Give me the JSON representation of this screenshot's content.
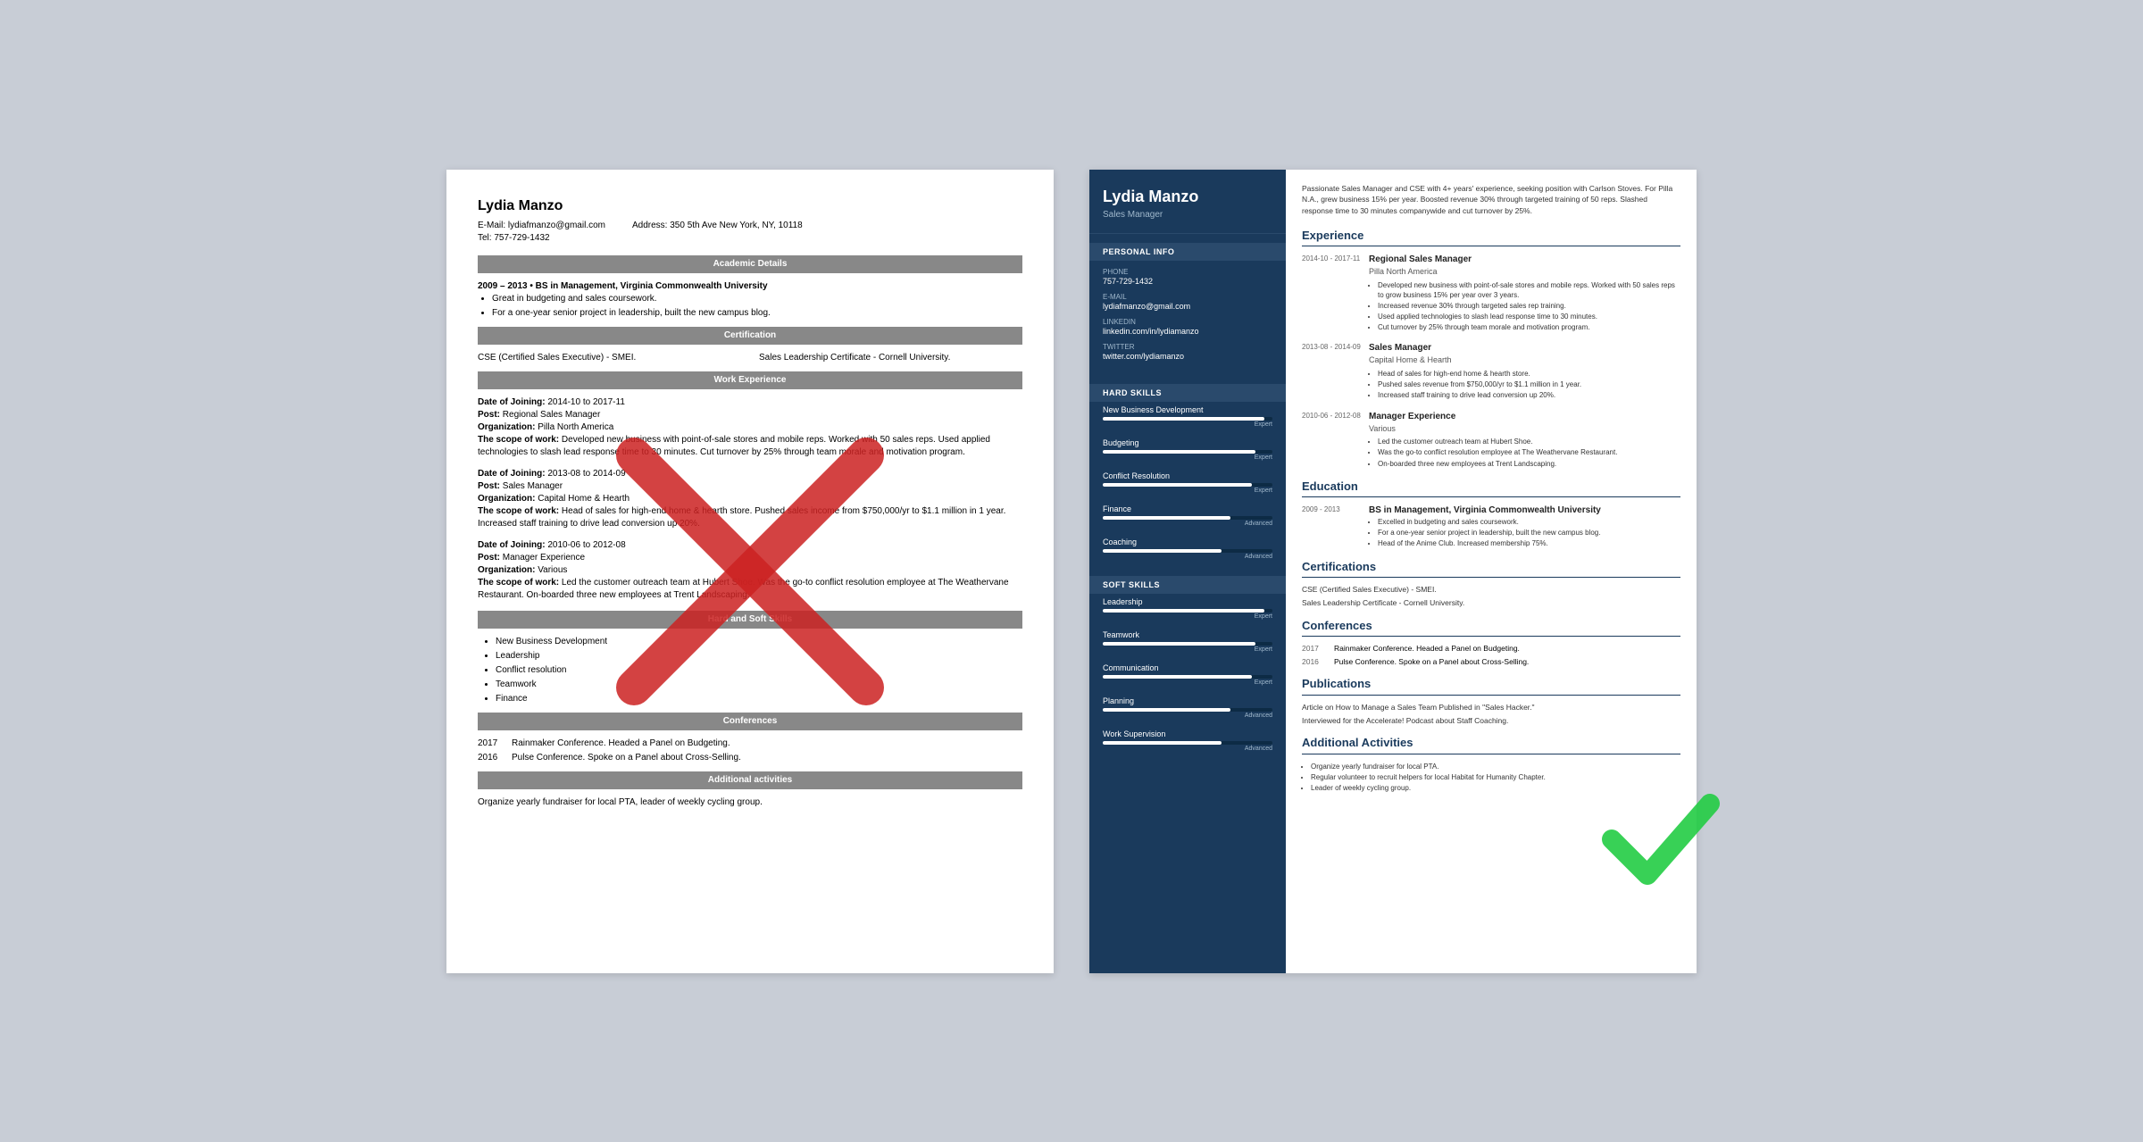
{
  "left_resume": {
    "name": "Lydia Manzo",
    "email_label": "E-Mail:",
    "email": "lydiafmanzo@gmail.com",
    "address_label": "Address:",
    "address": "350 5th Ave New York, NY, 10118",
    "tel_label": "Tel:",
    "tel": "757-729-1432",
    "sections": {
      "academic": "Academic Details",
      "academic_entry": "2009 – 2013 • BS in Management, Virginia Commonwealth University",
      "academic_bullets": [
        "Great in budgeting and sales coursework.",
        "For a one-year senior project in leadership, built the new campus blog."
      ],
      "certification": "Certification",
      "cert1": "CSE (Certified Sales Executive) - SMEI.",
      "cert2": "Sales Leadership Certificate - Cornell University.",
      "work": "Work Experience",
      "work_entries": [
        {
          "date_label": "Date of Joining:",
          "date": "2014-10 to 2017-11",
          "post_label": "Post:",
          "post": "Regional Sales Manager",
          "org_label": "Organization:",
          "org": "Pilla North America",
          "scope_label": "The scope of work:",
          "scope": "Developed new business with point-of-sale stores and mobile reps. Worked with 50 sales reps. Used applied technologies to slash lead response time to 30 minutes. Cut turnover by 25% through team morale and motivation program."
        },
        {
          "date_label": "Date of Joining:",
          "date": "2013-08 to 2014-09",
          "post_label": "Post:",
          "post": "Sales Manager",
          "org_label": "Organization:",
          "org": "Capital Home & Hearth",
          "scope_label": "The scope of work:",
          "scope": "Head of sales for high-end home & hearth store. Pushed sales income from $750,000/yr to $1.1 million in 1 year. Increased staff training to drive lead conversion up 20%."
        },
        {
          "date_label": "Date of Joining:",
          "date": "2010-06 to 2012-08",
          "post_label": "Post:",
          "post": "Manager Experience",
          "org_label": "Organization:",
          "org": "Various",
          "scope_label": "The scope of work:",
          "scope": "Led the customer outreach team at Hubert Shoe. Was the go-to conflict resolution employee at The Weathervane Restaurant. On-boarded three new employees at Trent Landscaping."
        }
      ],
      "skills": "Hard and Soft Skills",
      "skills_list": [
        "New Business Development",
        "Leadership",
        "Conflict resolution",
        "Teamwork",
        "Finance"
      ],
      "conferences": "Conferences",
      "conferences_list": [
        {
          "year": "2017",
          "text": "Rainmaker Conference. Headed a Panel on Budgeting."
        },
        {
          "year": "2016",
          "text": "Pulse Conference. Spoke on a Panel about Cross-Selling."
        }
      ],
      "additional": "Additional activities",
      "additional_text": "Organize yearly fundraiser for local PTA, leader of weekly cycling group."
    }
  },
  "right_resume": {
    "name": "Lydia Manzo",
    "title": "Sales Manager",
    "summary": "Passionate Sales Manager and CSE with 4+ years' experience, seeking position with Carlson Stoves. For Pilla N.A., grew business 15% per year. Boosted revenue 30% through targeted training of 50 reps. Slashed response time to 30 minutes companywide and cut turnover by 25%.",
    "personal_info_title": "Personal Info",
    "personal_info": [
      {
        "label": "Phone",
        "value": "757-729-1432"
      },
      {
        "label": "E-mail",
        "value": "lydiafmanzo@gmail.com"
      },
      {
        "label": "LinkedIn",
        "value": "linkedin.com/in/lydiamanzo"
      },
      {
        "label": "Twitter",
        "value": "twitter.com/lydiamanzo"
      }
    ],
    "hard_skills_title": "Hard Skills",
    "hard_skills": [
      {
        "name": "New Business Development",
        "level": "Expert",
        "pct": 95
      },
      {
        "name": "Budgeting",
        "level": "Expert",
        "pct": 90
      },
      {
        "name": "Conflict Resolution",
        "level": "Expert",
        "pct": 88
      },
      {
        "name": "Finance",
        "level": "Advanced",
        "pct": 75
      },
      {
        "name": "Coaching",
        "level": "Advanced",
        "pct": 70
      }
    ],
    "soft_skills_title": "Soft Skills",
    "soft_skills": [
      {
        "name": "Leadership",
        "level": "Expert",
        "pct": 95
      },
      {
        "name": "Teamwork",
        "level": "Expert",
        "pct": 90
      },
      {
        "name": "Communication",
        "level": "Expert",
        "pct": 88
      },
      {
        "name": "Planning",
        "level": "Advanced",
        "pct": 75
      },
      {
        "name": "Work Supervision",
        "level": "Advanced",
        "pct": 70
      }
    ],
    "experience_title": "Experience",
    "experience": [
      {
        "dates": "2014-10 - 2017-11",
        "title": "Regional Sales Manager",
        "company": "Pilla North America",
        "bullets": [
          "Developed new business with point-of-sale stores and mobile reps. Worked with 50 sales reps to grow business 15% per year over 3 years.",
          "Increased revenue 30% through targeted sales rep training.",
          "Used applied technologies to slash lead response time to 30 minutes.",
          "Cut turnover by 25% through team morale and motivation program."
        ]
      },
      {
        "dates": "2013-08 - 2014-09",
        "title": "Sales Manager",
        "company": "Capital Home & Hearth",
        "bullets": [
          "Head of sales for high-end home & hearth store.",
          "Pushed sales revenue from $750,000/yr to $1.1 million in 1 year.",
          "Increased staff training to drive lead conversion up 20%."
        ]
      },
      {
        "dates": "2010-06 - 2012-08",
        "title": "Manager Experience",
        "company": "Various",
        "bullets": [
          "Led the customer outreach team at Hubert Shoe.",
          "Was the go-to conflict resolution employee at The Weathervane Restaurant.",
          "On-boarded three new employees at Trent Landscaping."
        ]
      }
    ],
    "education_title": "Education",
    "education": [
      {
        "dates": "2009 - 2013",
        "title": "BS in Management, Virginia Commonwealth University",
        "bullets": [
          "Excelled in budgeting and sales coursework.",
          "For a one-year senior project in leadership, built the new campus blog.",
          "Head of the Anime Club. Increased membership 75%."
        ]
      }
    ],
    "certifications_title": "Certifications",
    "certifications": [
      "CSE (Certified Sales Executive) - SMEI.",
      "Sales Leadership Certificate - Cornell University."
    ],
    "conferences_title": "Conferences",
    "conferences": [
      {
        "year": "2017",
        "text": "Rainmaker Conference. Headed a Panel on Budgeting."
      },
      {
        "year": "2016",
        "text": "Pulse Conference. Spoke on a Panel about Cross-Selling."
      }
    ],
    "publications_title": "Publications",
    "publications": [
      "Article on How to Manage a Sales Team Published in \"Sales Hacker.\"",
      "Interviewed for the Accelerate! Podcast about Staff Coaching."
    ],
    "additional_title": "Additional Activities",
    "additional_bullets": [
      "Organize yearly fundraiser for local PTA.",
      "Regular volunteer to recruit helpers for local Habitat for Humanity Chapter.",
      "Leader of weekly cycling group."
    ]
  }
}
